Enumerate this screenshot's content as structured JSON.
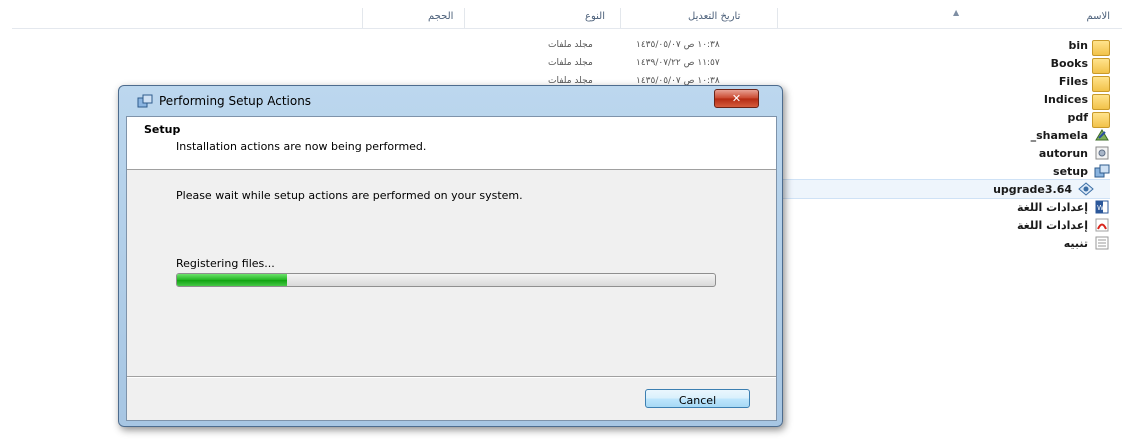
{
  "explorer": {
    "columns": {
      "name": "الاسم",
      "date": "تاريخ التعديل",
      "type": "النوع",
      "size": "الحجم"
    },
    "files": [
      {
        "name": "bin",
        "date": "١٠:٣٨ ص ١٤٣٥/٠٥/٠٧",
        "type": "مجلد ملفات",
        "icon": "folder-icon"
      },
      {
        "name": "Books",
        "date": "١١:٥٧ ص ١٤٣٩/٠٧/٢٢",
        "type": "مجلد ملفات",
        "icon": "folder-icon"
      },
      {
        "name": "Files",
        "date": "١٠:٣٨ ص ١٤٣٥/٠٥/٠٧",
        "type": "مجلد ملفات",
        "icon": "folder-icon"
      },
      {
        "name": "Indices",
        "icon": "folder-icon"
      },
      {
        "name": "pdf",
        "icon": "folder-icon"
      },
      {
        "name": "_shamela",
        "icon": "shamela-icon"
      },
      {
        "name": "autorun",
        "icon": "settings-file-icon"
      },
      {
        "name": "setup",
        "icon": "setup-icon"
      },
      {
        "name": "upgrade3.64",
        "icon": "upgrade-icon",
        "selected": true
      },
      {
        "name": "إعدادات اللغة",
        "icon": "word-doc-icon"
      },
      {
        "name": "إعدادات اللغة",
        "icon": "pdf-icon"
      },
      {
        "name": "تنبيه",
        "icon": "text-file-icon"
      }
    ]
  },
  "dialog": {
    "title": "Performing Setup Actions",
    "close_label": "✕",
    "banner_title": "Setup",
    "banner_subtitle": "Installation actions are now being performed.",
    "wait_message": "Please wait while setup actions are performed on your system.",
    "status": "Registering files...",
    "progress": 0.205,
    "cancel_label": "Cancel"
  },
  "colors": {
    "progress": "#22b422",
    "title_bar": "#bcd7ee",
    "close": "#c9452c"
  }
}
